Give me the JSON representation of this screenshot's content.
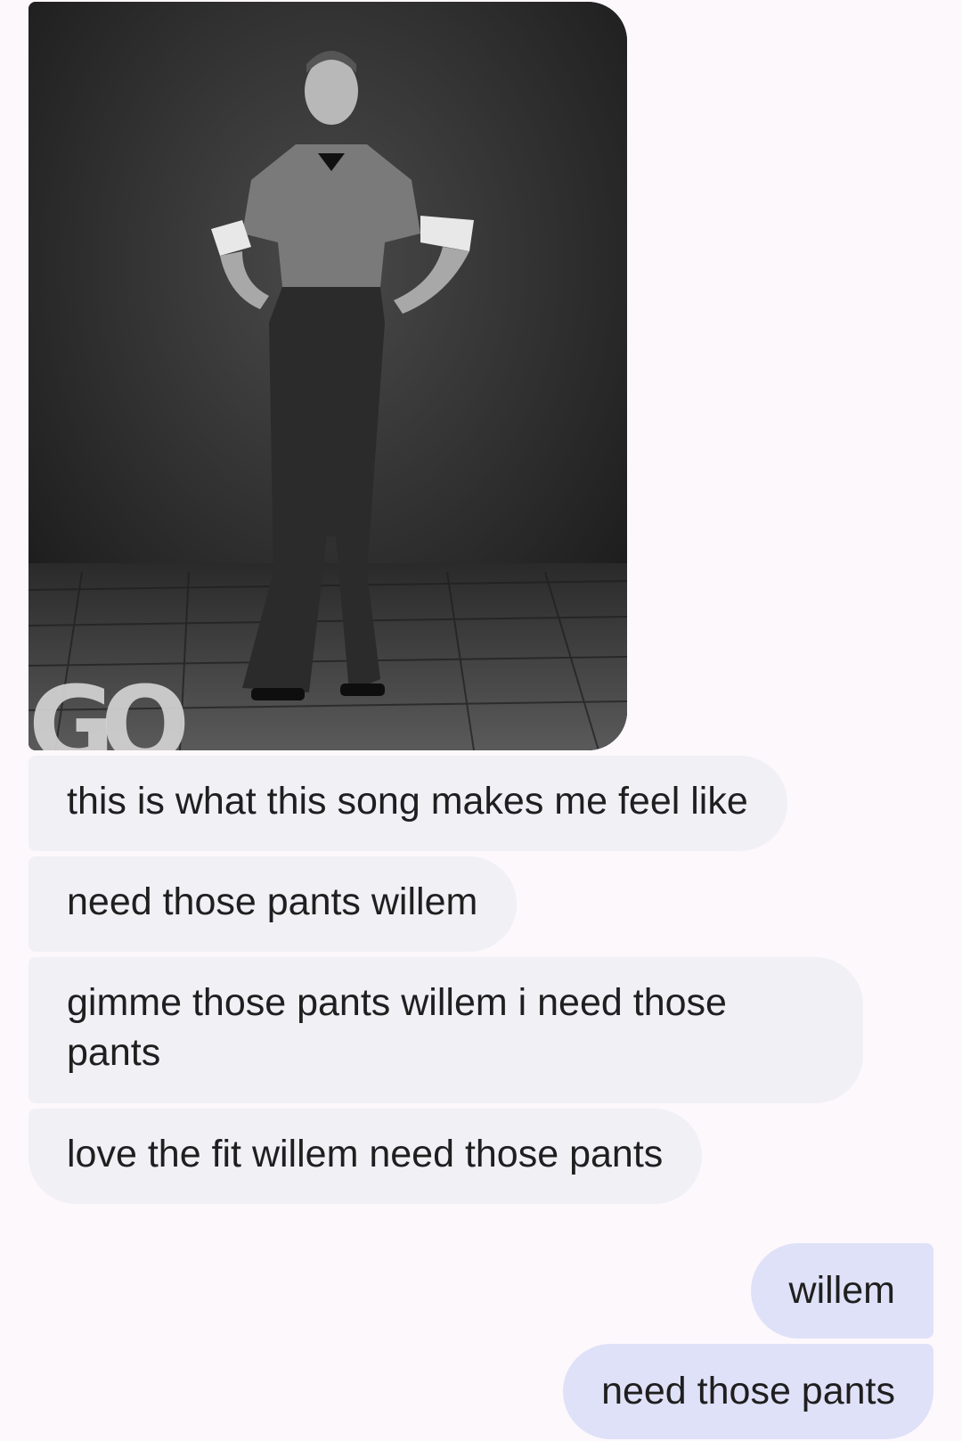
{
  "photo": {
    "description_icon": "photo-attachment",
    "logo_text": "GQ"
  },
  "messages": {
    "incoming": [
      "this is what this song makes me feel like",
      "need those pants willem",
      "gimme those pants willem i need those pants",
      "love the fit willem need those pants"
    ],
    "outgoing": [
      "willem",
      "need those pants"
    ]
  },
  "colors": {
    "background": "#fdf8fc",
    "incoming_bubble": "#f0f0f5",
    "outgoing_bubble": "#dfe1f8",
    "text": "#1f1f1f"
  }
}
